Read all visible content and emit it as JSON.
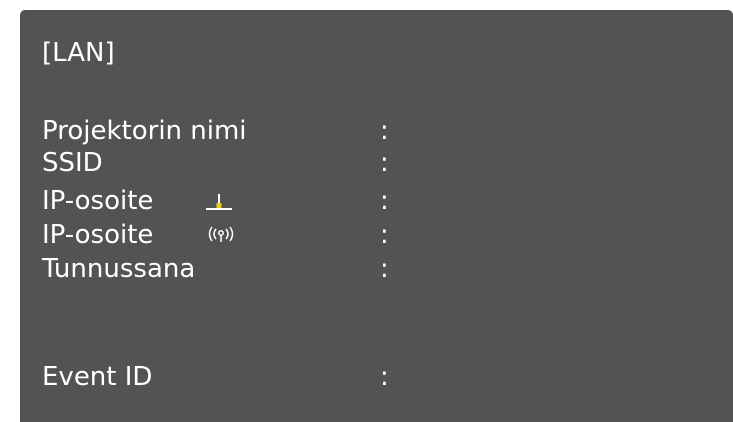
{
  "panel": {
    "title": "[LAN]",
    "rows": [
      {
        "label": "Projektorin nimi",
        "separator": ":"
      },
      {
        "label": "SSID",
        "separator": ":"
      },
      {
        "label": "IP-osoite",
        "separator": ":",
        "icon": "wired-lan-icon"
      },
      {
        "label": "IP-osoite",
        "separator": ":",
        "icon": "wireless-lan-icon"
      },
      {
        "label": "Tunnussana",
        "separator": ":"
      },
      {
        "label": "Event ID",
        "separator": ":"
      }
    ]
  },
  "colors": {
    "panel_bg": "#535353",
    "text": "#ffffff",
    "wired_icon_accent": "#e8d21a"
  }
}
